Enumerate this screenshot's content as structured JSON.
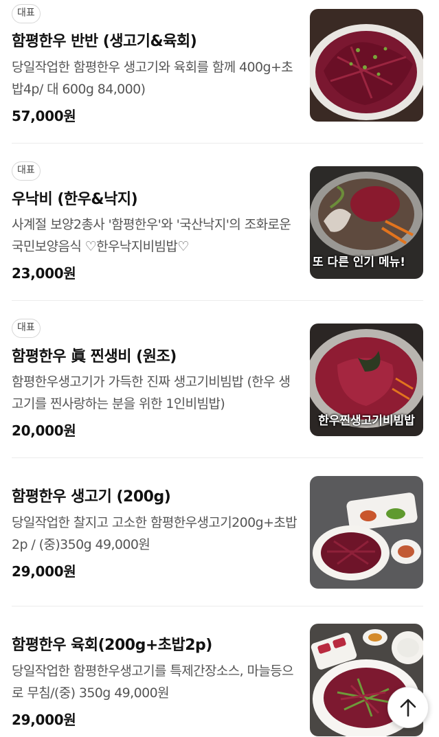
{
  "menu": {
    "items": [
      {
        "badge": "대표",
        "name": "함평한우 반반 (생고기&육회)",
        "description": "당일작업한 함평한우 생고기와 육회를 함께 400g+초밥4p/ 대 600g 84,000)",
        "price": "57,000원",
        "image_overlay": ""
      },
      {
        "badge": "대표",
        "name": "우낙비 (한우&낙지)",
        "description": "사계절 보양2총사 '함평한우'와 '국산낙지'의 조화로운 국민보양음식 ♡한우낙지비빔밥♡",
        "price": "23,000원",
        "image_overlay": "또 다른 인기 메뉴!"
      },
      {
        "badge": "대표",
        "name": "함평한우 眞 찐생비 (원조)",
        "description": "함평한우생고기가 가득한 진짜 생고기비빔밥 (한우 생고기를 찐사랑하는 분을 위한 1인비빔밥)",
        "price": "20,000원",
        "image_overlay": "한우찐생고기비빔밥"
      },
      {
        "badge": "",
        "name": "함평한우 생고기 (200g)",
        "description": "당일작업한 찰지고 고소한 함평한우생고기200g+초밥2p / (중)350g 49,000원",
        "price": "29,000원",
        "image_overlay": ""
      },
      {
        "badge": "",
        "name": "함평한우 육회(200g+초밥2p)",
        "description": "당일작업한 함평한우생고기를 특제간장소스, 마늘등으로 무침/(중) 350g 49,000원",
        "price": "29,000원",
        "image_overlay": ""
      }
    ]
  },
  "scroll_top": {
    "icon": "arrow-up-icon"
  },
  "colors": {
    "text": "#111111",
    "muted": "#555555",
    "divider": "#ececec",
    "badge_border": "#d6d6d6"
  }
}
